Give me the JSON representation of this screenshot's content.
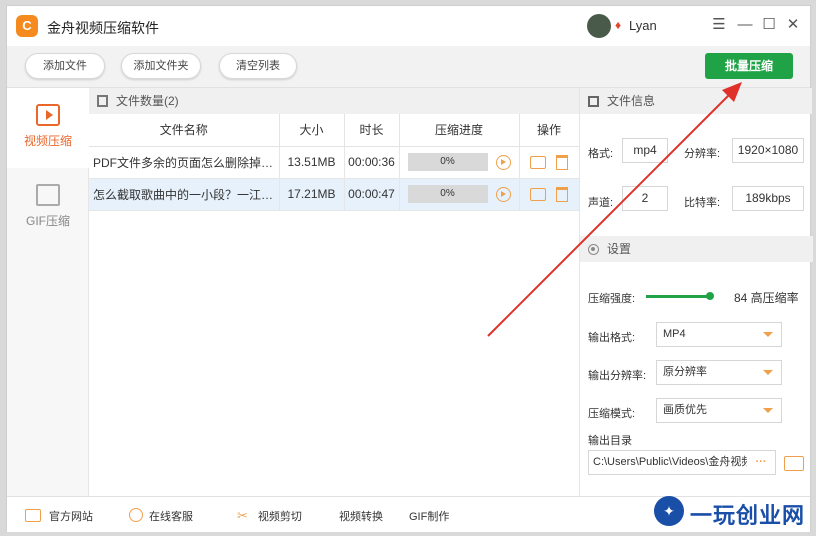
{
  "app": {
    "title": "金舟视频压缩软件",
    "logo_letter": "C",
    "user": "Lyan"
  },
  "window_controls": {
    "menu": "☰",
    "minimize": "—",
    "maximize": "☐",
    "close": "✕"
  },
  "toolbar": {
    "add_file": "添加文件",
    "add_folder": "添加文件夹",
    "clear_list": "清空列表",
    "batch_compress": "批量压缩"
  },
  "nav": {
    "video_compress": "视频压缩",
    "gif_compress": "GIF压缩"
  },
  "files": {
    "header": "文件数量(2)",
    "columns": [
      "文件名称",
      "大小",
      "时长",
      "压缩进度",
      "操作"
    ],
    "rows": [
      {
        "name": "PDF文件多余的页面怎么删除掉？...",
        "size": "13.51MB",
        "duration": "00:00:36",
        "progress": "0%"
      },
      {
        "name": "怎么截取歌曲中的一小段？一江下...",
        "size": "17.21MB",
        "duration": "00:00:47",
        "progress": "0%"
      }
    ]
  },
  "file_info": {
    "header": "文件信息",
    "format_label": "格式:",
    "format_value": "mp4",
    "resolution_label": "分辨率:",
    "resolution_value": "1920×1080",
    "channels_label": "声道:",
    "channels_value": "2",
    "bitrate_label": "比特率:",
    "bitrate_value": "189kbps"
  },
  "settings": {
    "header": "设置",
    "strength_label": "压缩强度:",
    "strength_value": 84,
    "strength_text": "84 高压缩率",
    "out_format_label": "输出格式:",
    "out_format_value": "MP4",
    "out_res_label": "输出分辨率:",
    "out_res_value": "原分辨率",
    "mode_label": "压缩模式:",
    "mode_value": "画质优先",
    "out_dir_label": "输出目录",
    "out_dir_value": "C:\\Users\\Public\\Videos\\金舟视频",
    "browse": "···"
  },
  "footer": {
    "website": "官方网站",
    "support": "在线客服",
    "cut": "视频剪切",
    "convert": "视频转换",
    "gif": "GIF制作"
  },
  "watermark": {
    "text": "一玩创业网"
  },
  "colors": {
    "accent_green": "#1fa346",
    "accent_orange": "#e9672b",
    "icon_orange": "#f0a04a",
    "arrow_red": "#e0302a",
    "selected_row": "#e6f1fb"
  }
}
